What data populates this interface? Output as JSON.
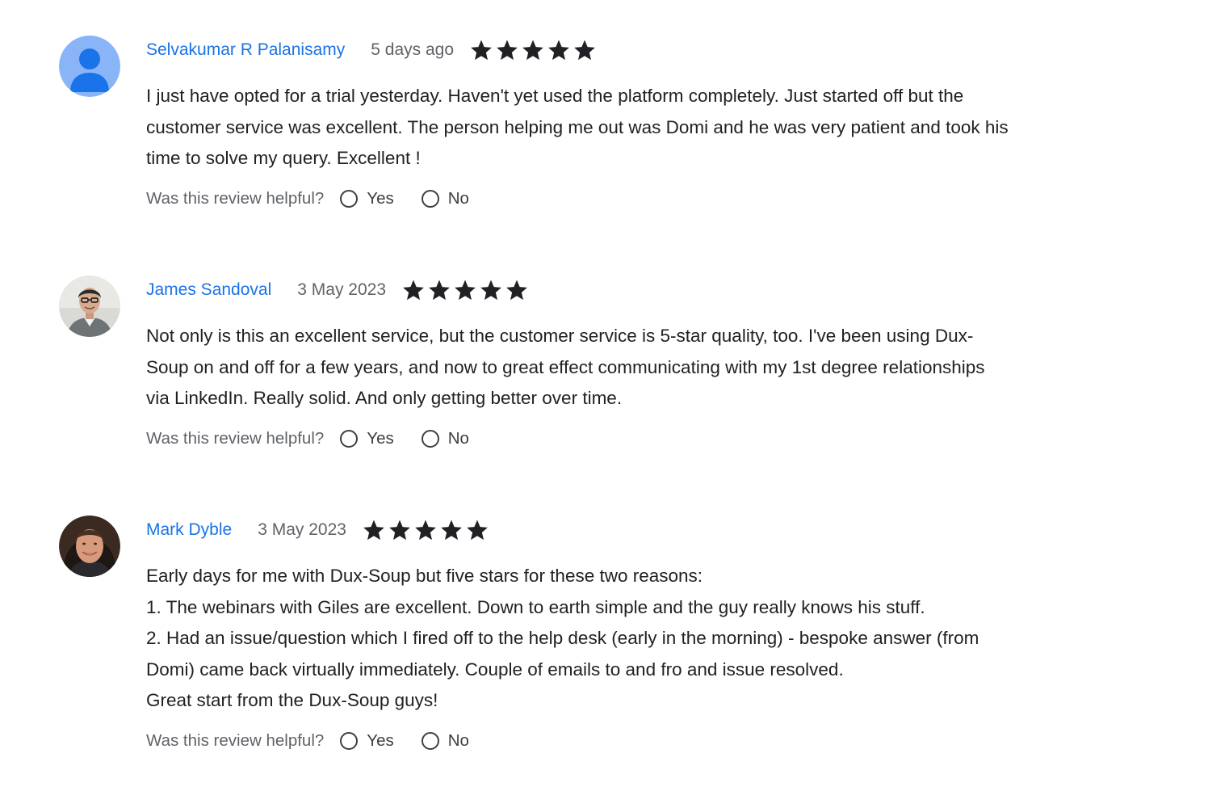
{
  "helpful_prompt": "Was this review helpful?",
  "yes_label": "Yes",
  "no_label": "No",
  "colors": {
    "author": "#1a73e8",
    "star": "#202124",
    "default_avatar_bg": "#8ab4f8",
    "default_avatar_fg": "#1a73e8"
  },
  "reviews": [
    {
      "author": "Selvakumar R Palanisamy",
      "date": "5 days ago",
      "rating": 5,
      "avatar": "default-person-icon",
      "body": [
        "I just have opted for a trial yesterday. Haven't yet used the platform completely. Just started off but the",
        "customer service was excellent. The person helping me out was Domi and he was very patient and took his",
        "time to solve my query. Excellent !"
      ]
    },
    {
      "author": "James Sandoval",
      "date": "3 May 2023",
      "rating": 5,
      "avatar": "profile-photo",
      "body": [
        "Not only is this an excellent service, but the customer service is 5-star quality, too. I've been using Dux-",
        "Soup on and off for a few years, and now to great effect communicating with my 1st degree relationships",
        "via LinkedIn. Really solid. And only getting better over time."
      ]
    },
    {
      "author": "Mark Dyble",
      "date": "3 May 2023",
      "rating": 5,
      "avatar": "profile-photo",
      "body": [
        "Early days for me with Dux-Soup but five stars for these two reasons:",
        "1. The webinars with Giles are excellent. Down to earth simple and the guy really knows his stuff.",
        "2. Had an issue/question which I fired off to the help desk (early in the morning) - bespoke answer (from",
        "Domi) came back virtually immediately. Couple of emails to and fro and issue resolved.",
        "Great start from the Dux-Soup guys!"
      ]
    }
  ]
}
